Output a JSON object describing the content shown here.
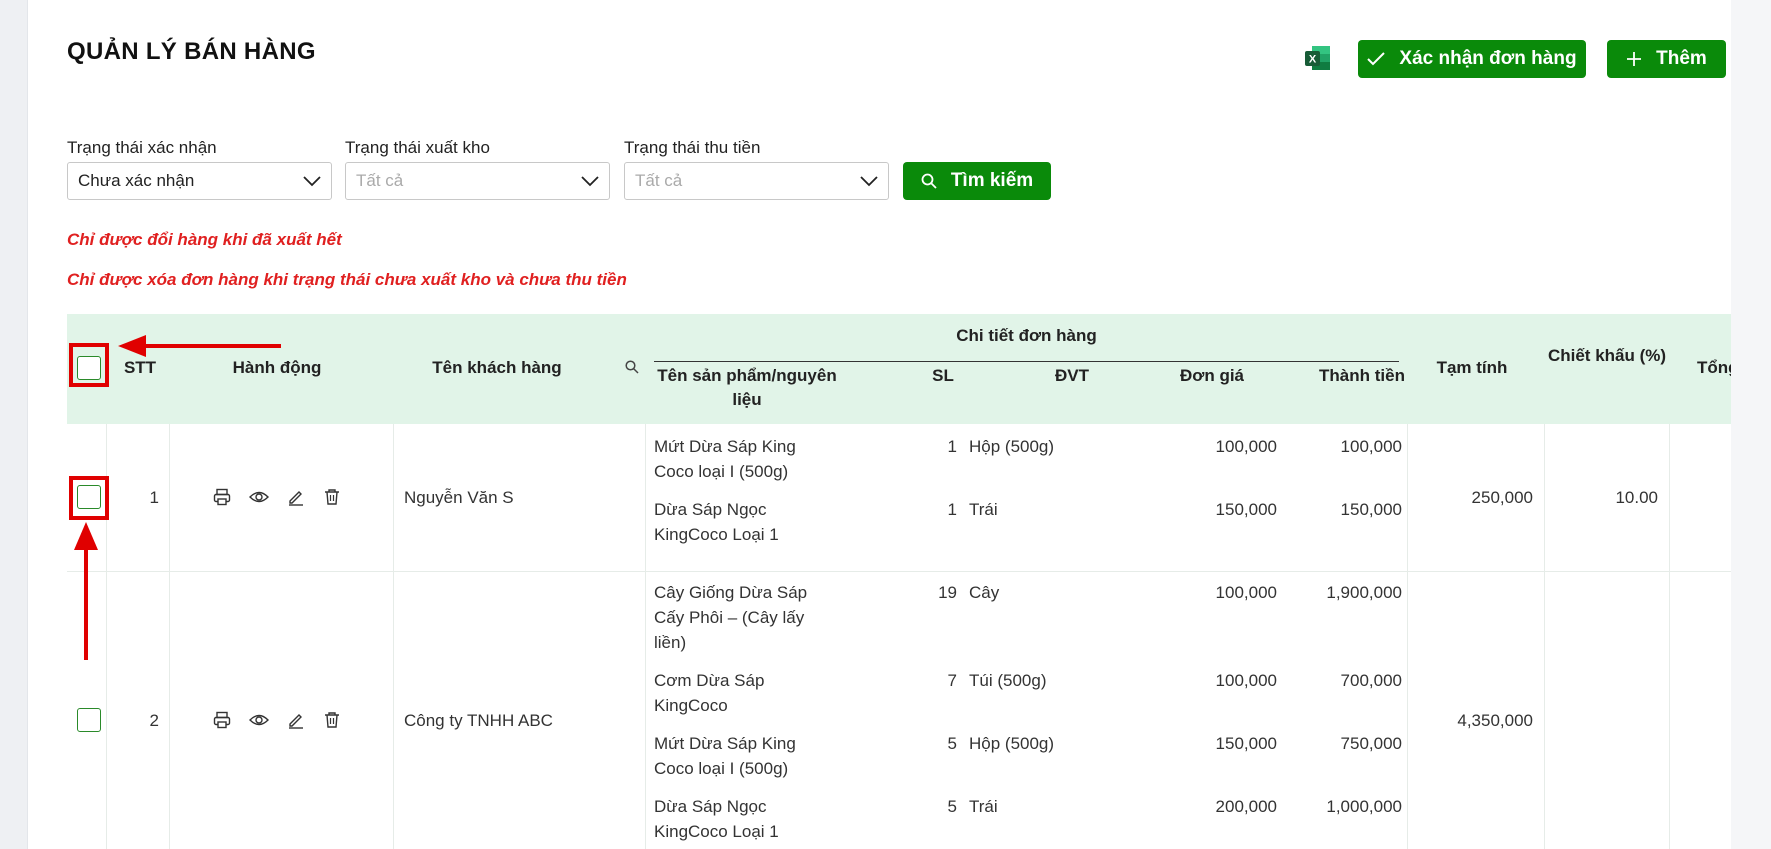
{
  "page": {
    "title": "QUẢN LÝ BÁN HÀNG"
  },
  "toolbar": {
    "excel_icon": "excel-icon",
    "confirm_label": "Xác nhận đơn hàng",
    "add_label": "Thêm"
  },
  "filters": {
    "confirm_status": {
      "label": "Trạng thái xác nhận",
      "value": "Chưa xác nhận"
    },
    "export_status": {
      "label": "Trạng thái xuất kho",
      "placeholder": "Tất cả"
    },
    "payment_status": {
      "label": "Trạng thái thu tiền",
      "placeholder": "Tất cả"
    },
    "search_label": "Tìm kiếm"
  },
  "notes": {
    "exchange": "Chỉ được đổi hàng khi đã xuất hết",
    "delete": "Chỉ được xóa đơn hàng khi trạng thái chưa xuất kho và chưa thu tiền"
  },
  "table": {
    "headers": {
      "stt": "STT",
      "actions": "Hành động",
      "customer": "Tên khách hàng",
      "details": "Chi tiết đơn hàng",
      "product": "Tên sản phẩm/nguyên liệu",
      "qty": "SL",
      "unit": "ĐVT",
      "price": "Đơn giá",
      "amount": "Thành tiền",
      "subtotal": "Tạm tính",
      "discount": "Chiết khấu (%)",
      "total": "Tổng"
    },
    "rows": [
      {
        "stt": "1",
        "customer": "Nguyễn Văn S",
        "subtotal": "250,000",
        "discount": "10.00",
        "items": [
          {
            "product": "Mứt Dừa Sáp King Coco loại I (500g)",
            "qty": "1",
            "unit": "Hộp (500g)",
            "price": "100,000",
            "amount": "100,000"
          },
          {
            "product": "Dừa Sáp Ngọc KingCoco Loại 1",
            "qty": "1",
            "unit": "Trái",
            "price": "150,000",
            "amount": "150,000"
          }
        ]
      },
      {
        "stt": "2",
        "customer": "Công ty TNHH ABC",
        "subtotal": "4,350,000",
        "discount": "",
        "items": [
          {
            "product": "Cây Giống Dừa Sáp Cấy Phôi – (Cây lấy liền)",
            "qty": "19",
            "unit": "Cây",
            "price": "100,000",
            "amount": "1,900,000"
          },
          {
            "product": "Cơm Dừa Sáp KingCoco",
            "qty": "7",
            "unit": "Túi (500g)",
            "price": "100,000",
            "amount": "700,000"
          },
          {
            "product": "Mứt Dừa Sáp King Coco loại I (500g)",
            "qty": "5",
            "unit": "Hộp (500g)",
            "price": "150,000",
            "amount": "750,000"
          },
          {
            "product": "Dừa Sáp Ngọc KingCoco Loại 1",
            "qty": "5",
            "unit": "Trái",
            "price": "200,000",
            "amount": "1,000,000"
          }
        ]
      }
    ]
  },
  "colors": {
    "brand_green": "#0a8a0a",
    "header_bg": "#e1f4e8",
    "warning_red": "#e02020",
    "annotation_red": "#e00000"
  }
}
